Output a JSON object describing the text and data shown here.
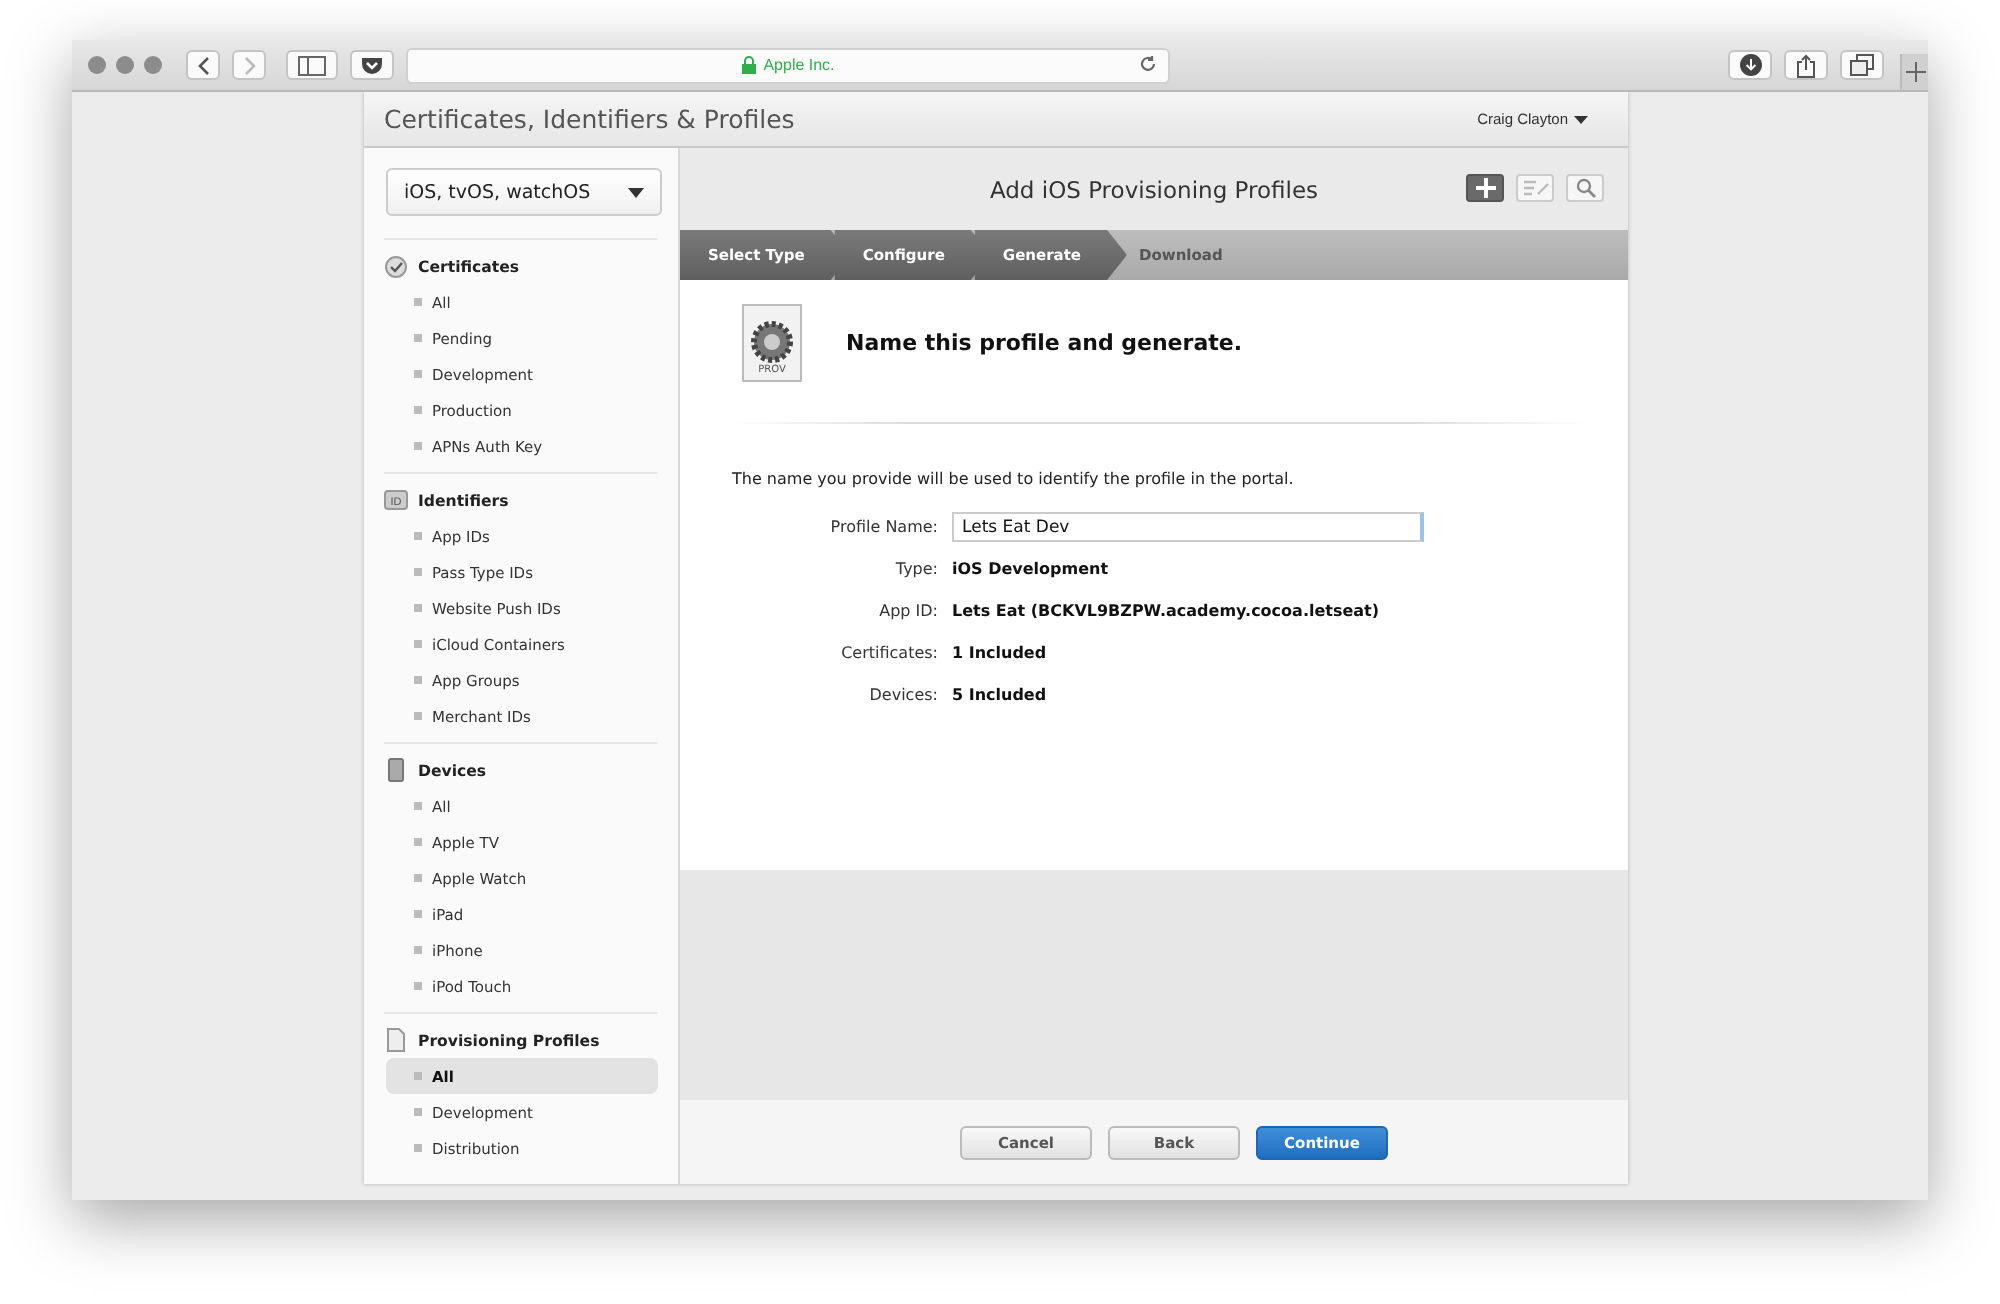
{
  "browser": {
    "address": "Apple Inc."
  },
  "header": {
    "title": "Certificates, Identifiers & Profiles",
    "user": "Craig Clayton"
  },
  "sidebar": {
    "platform": "iOS, tvOS, watchOS",
    "sections": [
      {
        "kind": "certificate",
        "title": "Certificates",
        "items": [
          {
            "label": "All",
            "selected": false
          },
          {
            "label": "Pending",
            "selected": false
          },
          {
            "label": "Development",
            "selected": false
          },
          {
            "label": "Production",
            "selected": false
          },
          {
            "label": "APNs Auth Key",
            "selected": false
          }
        ]
      },
      {
        "kind": "id",
        "badge": "ID",
        "title": "Identifiers",
        "items": [
          {
            "label": "App IDs",
            "selected": false
          },
          {
            "label": "Pass Type IDs",
            "selected": false
          },
          {
            "label": "Website Push IDs",
            "selected": false
          },
          {
            "label": "iCloud Containers",
            "selected": false
          },
          {
            "label": "App Groups",
            "selected": false
          },
          {
            "label": "Merchant IDs",
            "selected": false
          }
        ]
      },
      {
        "kind": "device",
        "title": "Devices",
        "items": [
          {
            "label": "All",
            "selected": false
          },
          {
            "label": "Apple TV",
            "selected": false
          },
          {
            "label": "Apple Watch",
            "selected": false
          },
          {
            "label": "iPad",
            "selected": false
          },
          {
            "label": "iPhone",
            "selected": false
          },
          {
            "label": "iPod Touch",
            "selected": false
          }
        ]
      },
      {
        "kind": "document",
        "title": "Provisioning Profiles",
        "items": [
          {
            "label": "All",
            "selected": true
          },
          {
            "label": "Development",
            "selected": false
          },
          {
            "label": "Distribution",
            "selected": false
          }
        ]
      }
    ]
  },
  "main": {
    "title": "Add iOS Provisioning Profiles",
    "tools": [
      {
        "kind": "add",
        "selected": true
      },
      {
        "kind": "edit",
        "selected": false
      },
      {
        "kind": "search",
        "selected": false
      }
    ],
    "steps": [
      {
        "label": "Select Type",
        "completed": true
      },
      {
        "label": "Configure",
        "completed": true
      },
      {
        "label": "Generate",
        "completed": true
      },
      {
        "label": "Download",
        "completed": false
      }
    ],
    "file_badge": "PROV",
    "heading": "Name this profile and generate.",
    "intro": "The name you provide will be used to identify the profile in the portal.",
    "fields": [
      {
        "kind": "input",
        "label": "Profile Name:",
        "value": "Lets Eat Dev"
      },
      {
        "kind": "text",
        "label": "Type:",
        "value": "iOS Development"
      },
      {
        "kind": "text",
        "label": "App ID:",
        "value": "Lets Eat (BCKVL9BZPW.academy.cocoa.letseat)"
      },
      {
        "kind": "text",
        "label": "Certificates:",
        "value": "1 Included"
      },
      {
        "kind": "text",
        "label": "Devices:",
        "value": "5 Included"
      }
    ],
    "buttons": [
      {
        "label": "Cancel",
        "kind": "secondary"
      },
      {
        "label": "Back",
        "kind": "secondary"
      },
      {
        "label": "Continue",
        "kind": "primary"
      }
    ]
  }
}
